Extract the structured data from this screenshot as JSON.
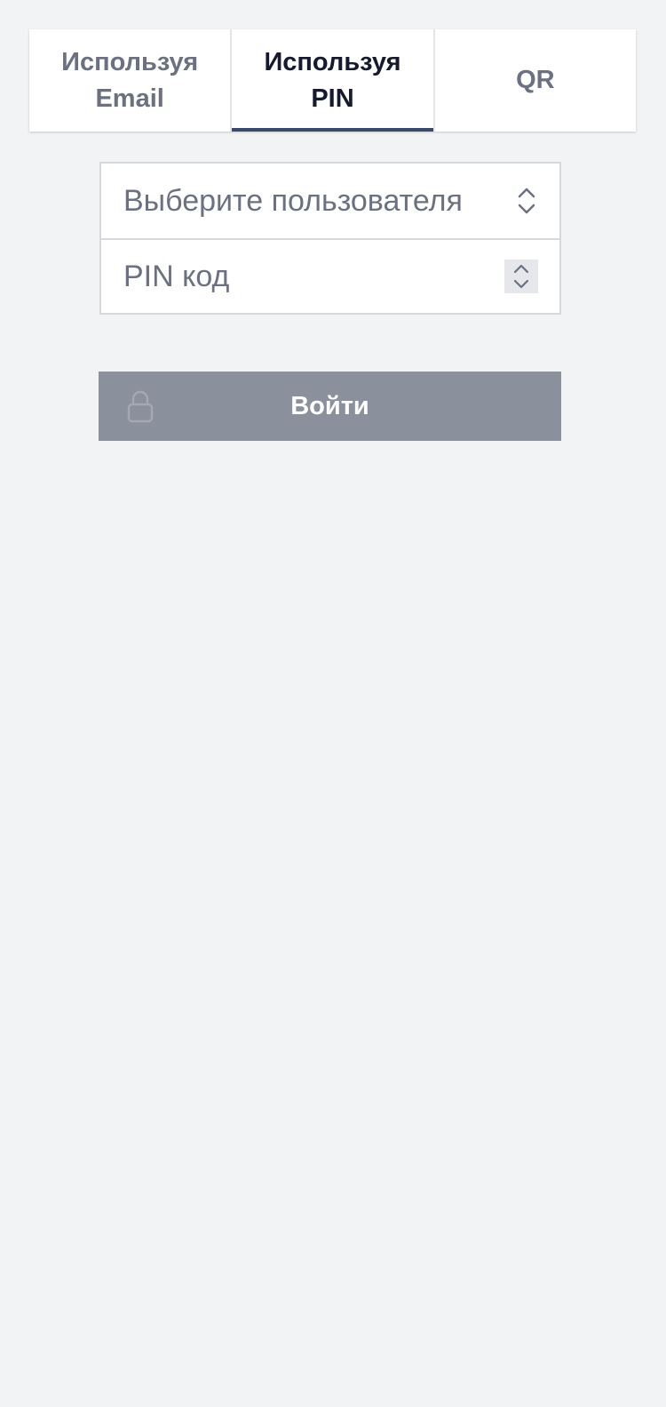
{
  "tabs": [
    {
      "label": "Используя Email",
      "active": false
    },
    {
      "label": "Используя PIN",
      "active": true
    },
    {
      "label": "QR",
      "active": false
    }
  ],
  "form": {
    "user_select": {
      "placeholder": "Выберите пользователя",
      "icon": "chevron-up-down-icon"
    },
    "pin_field": {
      "placeholder": "PIN код",
      "icon": "stepper-arrows-icon"
    }
  },
  "login_button": {
    "label": "Войти",
    "icon": "lock-icon"
  },
  "colors": {
    "background": "#f2f3f5",
    "tab_active_text": "#161a2c",
    "tab_inactive_text": "#6b7180",
    "tab_underline": "#3b4a6b",
    "button_bg": "#8a909c",
    "button_text": "#ffffff"
  }
}
